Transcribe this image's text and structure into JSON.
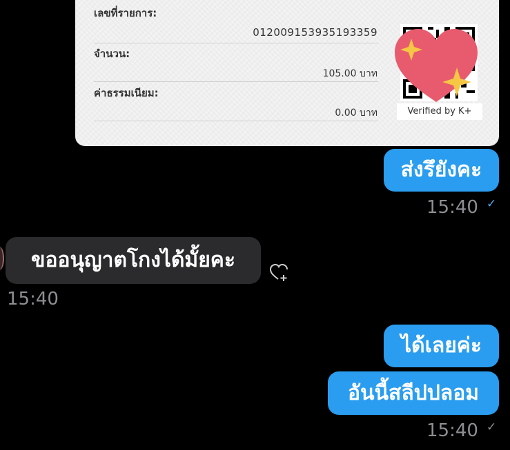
{
  "slip": {
    "ref_label": "เลขที่รายการ:",
    "ref_value": "012009153935193359",
    "amount_label": "จำนวน:",
    "amount_value": "105.00 บาท",
    "fee_label": "ค่าธรรมเนียม:",
    "fee_value": "0.00 บาท",
    "verified": "Verified by K+",
    "sticker_icon": "heart-sparkle-icon"
  },
  "messages": [
    {
      "side": "out",
      "text": "ส่งรึยังคะ",
      "time": "15:40",
      "status_icon": "sent-check-icon"
    },
    {
      "side": "in",
      "text": "ขออนุญาตโกงได้มั้ยคะ",
      "time": "15:40",
      "reaction_icon": "add-reaction-heart-icon"
    },
    {
      "side": "out",
      "text": "ได้เลยค่ะ"
    },
    {
      "side": "out",
      "text": "อันนี้สลีปปลอม",
      "time": "15:40",
      "status_icon": "sent-check-icon"
    }
  ],
  "colors": {
    "outgoing_bubble": "#2a9df0",
    "incoming_bubble": "#2b2b2d",
    "timestamp": "#8e8e93",
    "background": "#000000"
  }
}
